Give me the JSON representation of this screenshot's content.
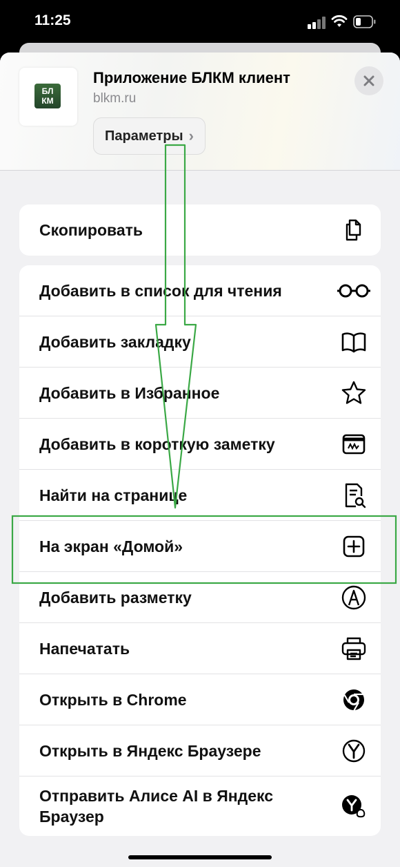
{
  "status_bar": {
    "time": "11:25"
  },
  "header": {
    "app_title": "Приложение БЛКМ клиент",
    "url": "blkm.ru",
    "params_label": "Параметры",
    "logo_line1": "БЛ",
    "logo_line2": "КМ"
  },
  "menu": {
    "copy": {
      "label": "Скопировать",
      "icon": "copy-icon"
    },
    "items": [
      {
        "label": "Добавить в список для чтения",
        "icon": "glasses-icon"
      },
      {
        "label": "Добавить закладку",
        "icon": "book-icon"
      },
      {
        "label": "Добавить в Избранное",
        "icon": "star-icon"
      },
      {
        "label": "Добавить в короткую заметку",
        "icon": "quick-note-icon"
      },
      {
        "label": "Найти на странице",
        "icon": "find-in-page-icon"
      },
      {
        "label": "На экран «Домой»",
        "icon": "add-square-icon"
      },
      {
        "label": "Добавить разметку",
        "icon": "markup-icon"
      },
      {
        "label": "Напечатать",
        "icon": "printer-icon"
      },
      {
        "label": "Открыть в Chrome",
        "icon": "chrome-icon"
      },
      {
        "label": "Открыть в Яндекс Браузере",
        "icon": "yandex-browser-icon"
      },
      {
        "label": "Отправить Алисе AI в Яндекс Браузер",
        "icon": "alice-icon"
      }
    ]
  },
  "annotation_color": "#3aa845"
}
